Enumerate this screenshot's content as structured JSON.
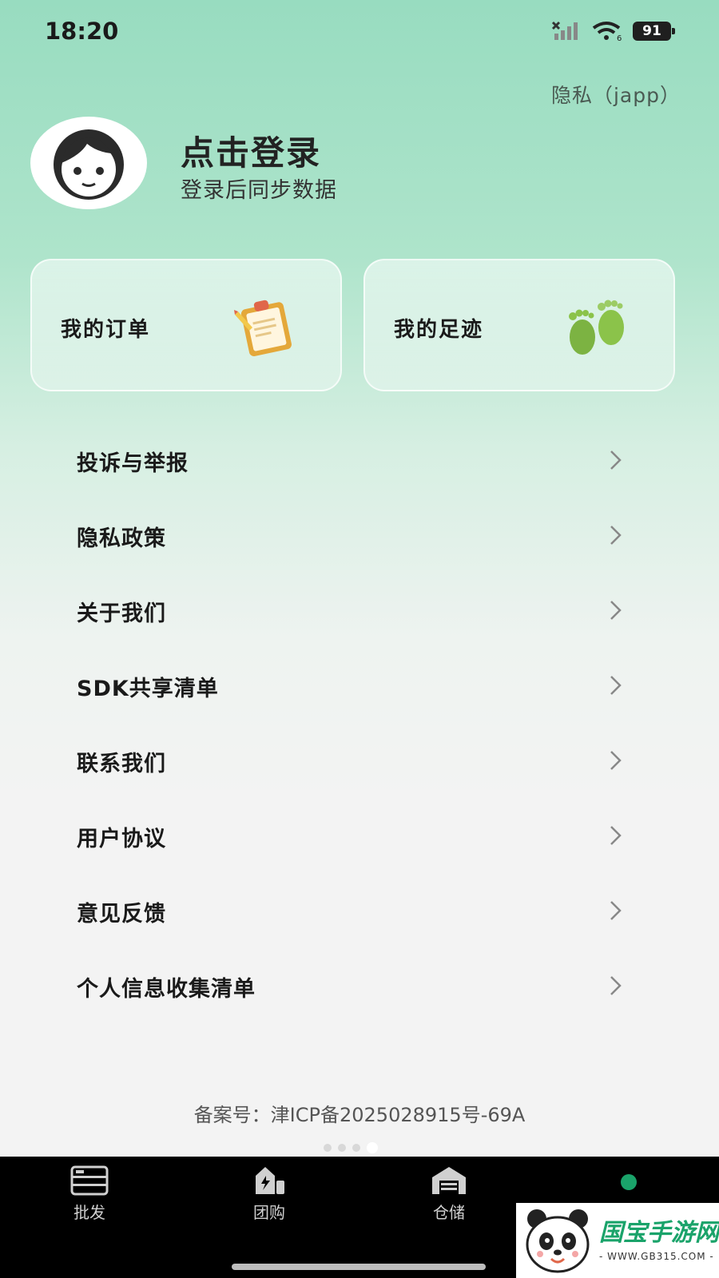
{
  "status_bar": {
    "time": "18:20",
    "battery": "91"
  },
  "header": {
    "privacy_link": "隐私（japp）"
  },
  "profile": {
    "title": "点击登录",
    "subtitle": "登录后同步数据"
  },
  "cards": [
    {
      "label": "我的订单",
      "icon": "clipboard-icon"
    },
    {
      "label": "我的足迹",
      "icon": "footprints-icon"
    }
  ],
  "menu": [
    {
      "label": "投诉与举报"
    },
    {
      "label": "隐私政策"
    },
    {
      "label": "关于我们"
    },
    {
      "label": "SDK共享清单"
    },
    {
      "label": "联系我们"
    },
    {
      "label": "用户协议"
    },
    {
      "label": "意见反馈"
    },
    {
      "label": "个人信息收集清单"
    }
  ],
  "footer": {
    "icp": "备案号：津ICP备2025028915号-69A"
  },
  "tabs": [
    {
      "label": "批发",
      "icon": "wholesale-icon"
    },
    {
      "label": "团购",
      "icon": "group-buy-icon"
    },
    {
      "label": "仓储",
      "icon": "warehouse-icon"
    },
    {
      "label": "",
      "icon": "profile-icon"
    }
  ],
  "watermark": {
    "name": "国宝手游网",
    "url": "- WWW.GB315.COM -"
  },
  "colors": {
    "accent_green": "#1aa36a",
    "tab_bar_bg": "#000000",
    "gradient_top": "#98dcc0"
  }
}
